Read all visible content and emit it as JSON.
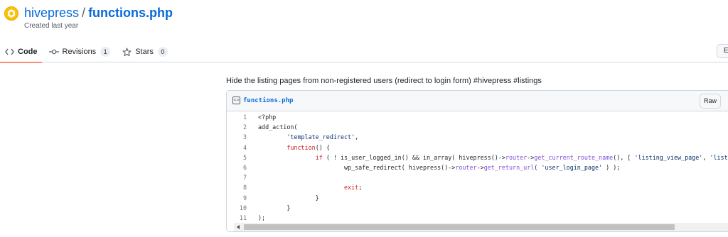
{
  "header": {
    "owner": "hivepress",
    "separator": "/",
    "filename": "functions.php",
    "created": "Created last year",
    "avatar_icon": "hive-logo-icon"
  },
  "tabs": [
    {
      "label": "Code",
      "icon": "code-icon",
      "active": true
    },
    {
      "label": "Revisions",
      "icon": "git-commit-icon",
      "count": "1"
    },
    {
      "label": "Stars",
      "icon": "star-icon",
      "count": "0"
    }
  ],
  "edge_button": {
    "label": "E"
  },
  "description": "Hide the listing pages from non-registered users (redirect to login form) #hivepress #listings",
  "file": {
    "name": "functions.php",
    "raw_label": "Raw",
    "icon": "file-code-icon"
  },
  "code": {
    "line_numbers": [
      "1",
      "2",
      "3",
      "4",
      "5",
      "6",
      "7",
      "8",
      "9",
      "10",
      "11"
    ]
  },
  "colors": {
    "link": "#0969da",
    "active_tab_underline": "#fd8c73",
    "keyword": "#cf222e",
    "string": "#0a3069",
    "function": "#8250df"
  }
}
